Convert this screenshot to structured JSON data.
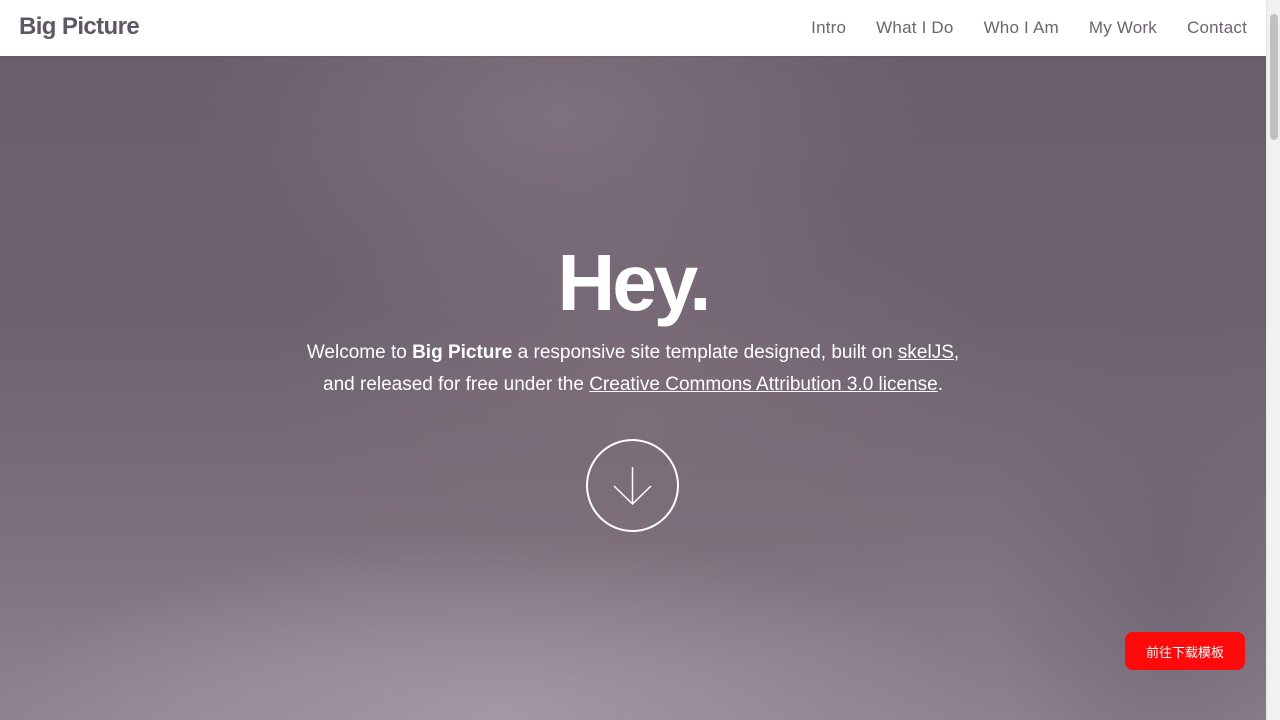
{
  "header": {
    "logo": "Big Picture",
    "nav": {
      "items": [
        {
          "label": "Intro"
        },
        {
          "label": "What I Do"
        },
        {
          "label": "Who I Am"
        },
        {
          "label": "My Work"
        },
        {
          "label": "Contact"
        }
      ]
    }
  },
  "hero": {
    "title": "Hey.",
    "text": {
      "part1": "Welcome to ",
      "brand": "Big Picture",
      "part2": " a responsive site template designed, built on ",
      "link1": "skelJS",
      "part3": ",",
      "part4": "and released for free under the ",
      "link2": "Creative Commons Attribution 3.0 license",
      "part5": "."
    },
    "scroll_icon": "arrow-down-icon"
  },
  "download": {
    "label": "前往下载模板",
    "color": "#ff0a0a"
  },
  "colors": {
    "logo": "#5f5666",
    "nav_text": "#6b6570",
    "hero_bg": "#6e6270",
    "hero_text": "#ffffff"
  }
}
